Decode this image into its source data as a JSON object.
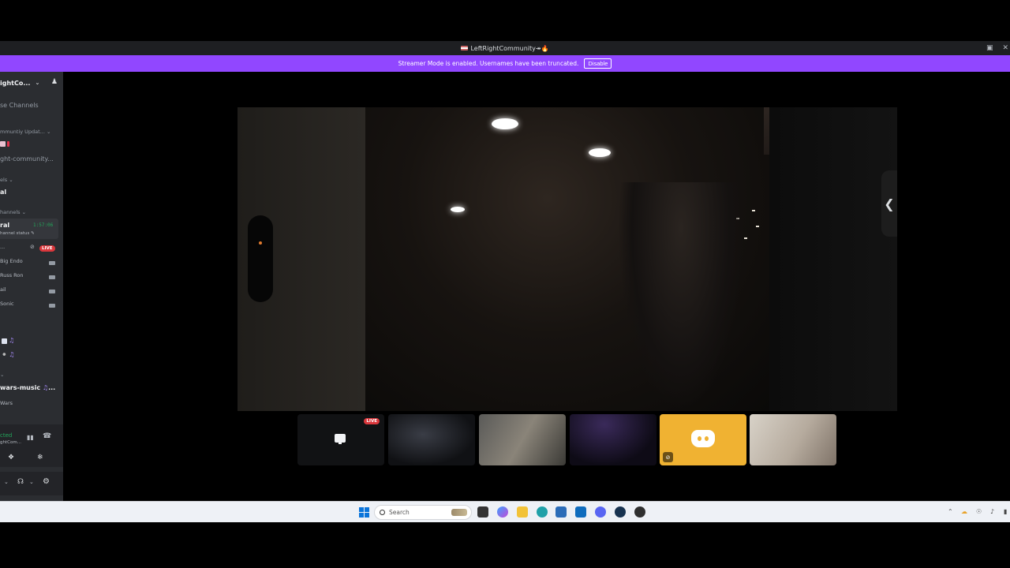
{
  "window": {
    "title": "LeftRightCommunity↠🔥",
    "buttons": [
      "inbox-icon",
      "close-icon"
    ]
  },
  "banner": {
    "message": "Streamer Mode is enabled. Usernames have been truncated.",
    "disable_label": "Disable",
    "color": "#9147ff"
  },
  "sidebar": {
    "server_name": "ightCo...",
    "browse_channels": "se Channels",
    "categories": {
      "updates": "mmuntiy Updat...",
      "channels_1": "els",
      "channels_2": "hannels"
    },
    "channels": {
      "community": "ght-community...",
      "general_text": "al",
      "general_voice": "ral",
      "channel_status": "hannel status",
      "music": "wars-music",
      "wars": "Wars"
    },
    "voice_timer": "1:57:06",
    "live_label": "LIVE",
    "voice_users": [
      "Big Endo",
      "Russ Ron",
      "ail",
      "Sonic"
    ],
    "voice_panel": {
      "status": "cted",
      "server": "ghtCom..."
    }
  },
  "stage": {
    "side_toggle": "❮",
    "tiles": [
      {
        "kind": "screen-share",
        "live": "LIVE"
      },
      {
        "kind": "video"
      },
      {
        "kind": "video"
      },
      {
        "kind": "video"
      },
      {
        "kind": "avatar",
        "muted": true,
        "color": "#f0b232"
      },
      {
        "kind": "video"
      }
    ]
  },
  "taskbar": {
    "search_placeholder": "Search",
    "tray_icons": [
      "chevron-up-icon",
      "onedrive-icon",
      "network-icon",
      "volume-icon",
      "battery-icon"
    ]
  },
  "colors": {
    "sidebar_bg": "#2b2d31",
    "panel_bg": "#232428",
    "live_red": "#da373c",
    "timer_green": "#23a55a"
  }
}
